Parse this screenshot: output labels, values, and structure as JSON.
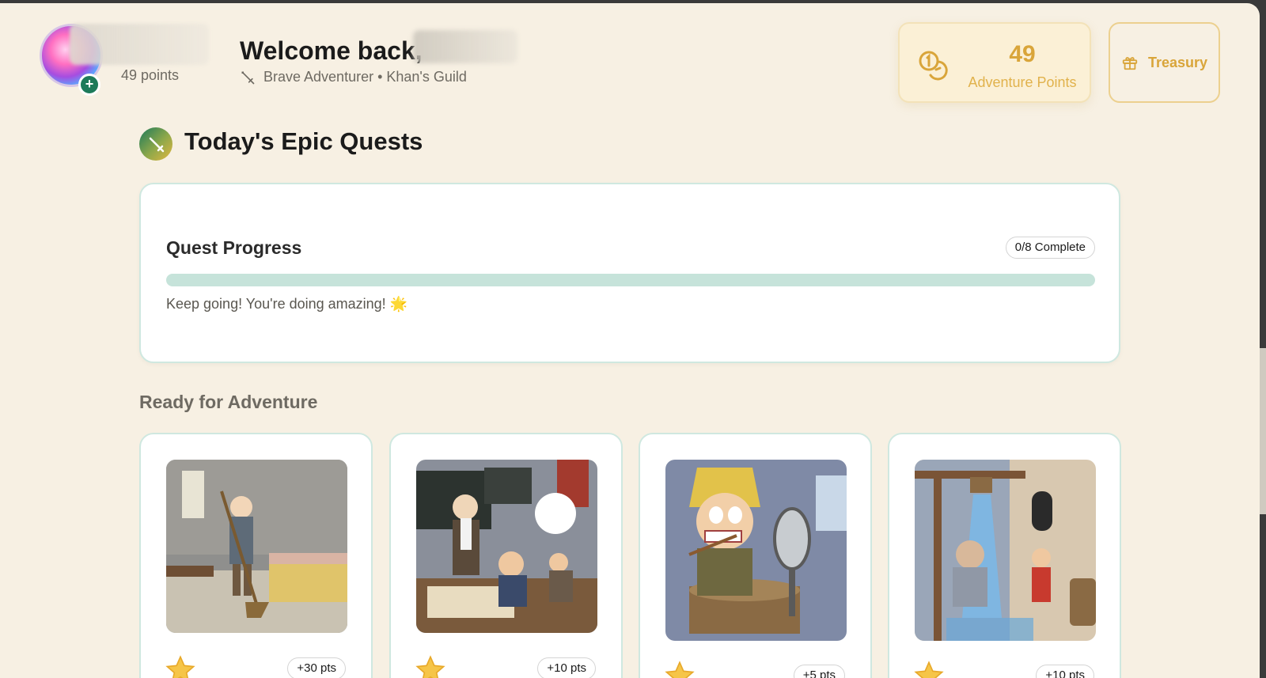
{
  "header": {
    "user_points": "49 points",
    "welcome": "Welcome back,",
    "subtitle": "Brave Adventurer • Khan's Guild",
    "adventure_points": "49",
    "adventure_points_label": "Adventure Points",
    "treasury_label": "Treasury"
  },
  "quests": {
    "title": "Today's Epic Quests",
    "progress": {
      "title": "Quest Progress",
      "badge": "0/8 Complete",
      "completed": 0,
      "total": 8,
      "message": "Keep going! You're doing amazing! 🌟"
    },
    "ready_title": "Ready for Adventure",
    "cards": [
      {
        "points": "+30 pts",
        "image": "medieval-sweeping-chore"
      },
      {
        "points": "+10 pts",
        "image": "medieval-homework-study"
      },
      {
        "points": "+5 pts",
        "image": "medieval-brushing-teeth"
      },
      {
        "points": "+10 pts",
        "image": "medieval-shower-bath"
      }
    ]
  },
  "colors": {
    "background": "#f7f0e3",
    "accent_green": "#1d7a5a",
    "gold": "#d9a53a",
    "card_border": "#cfe8e0"
  }
}
